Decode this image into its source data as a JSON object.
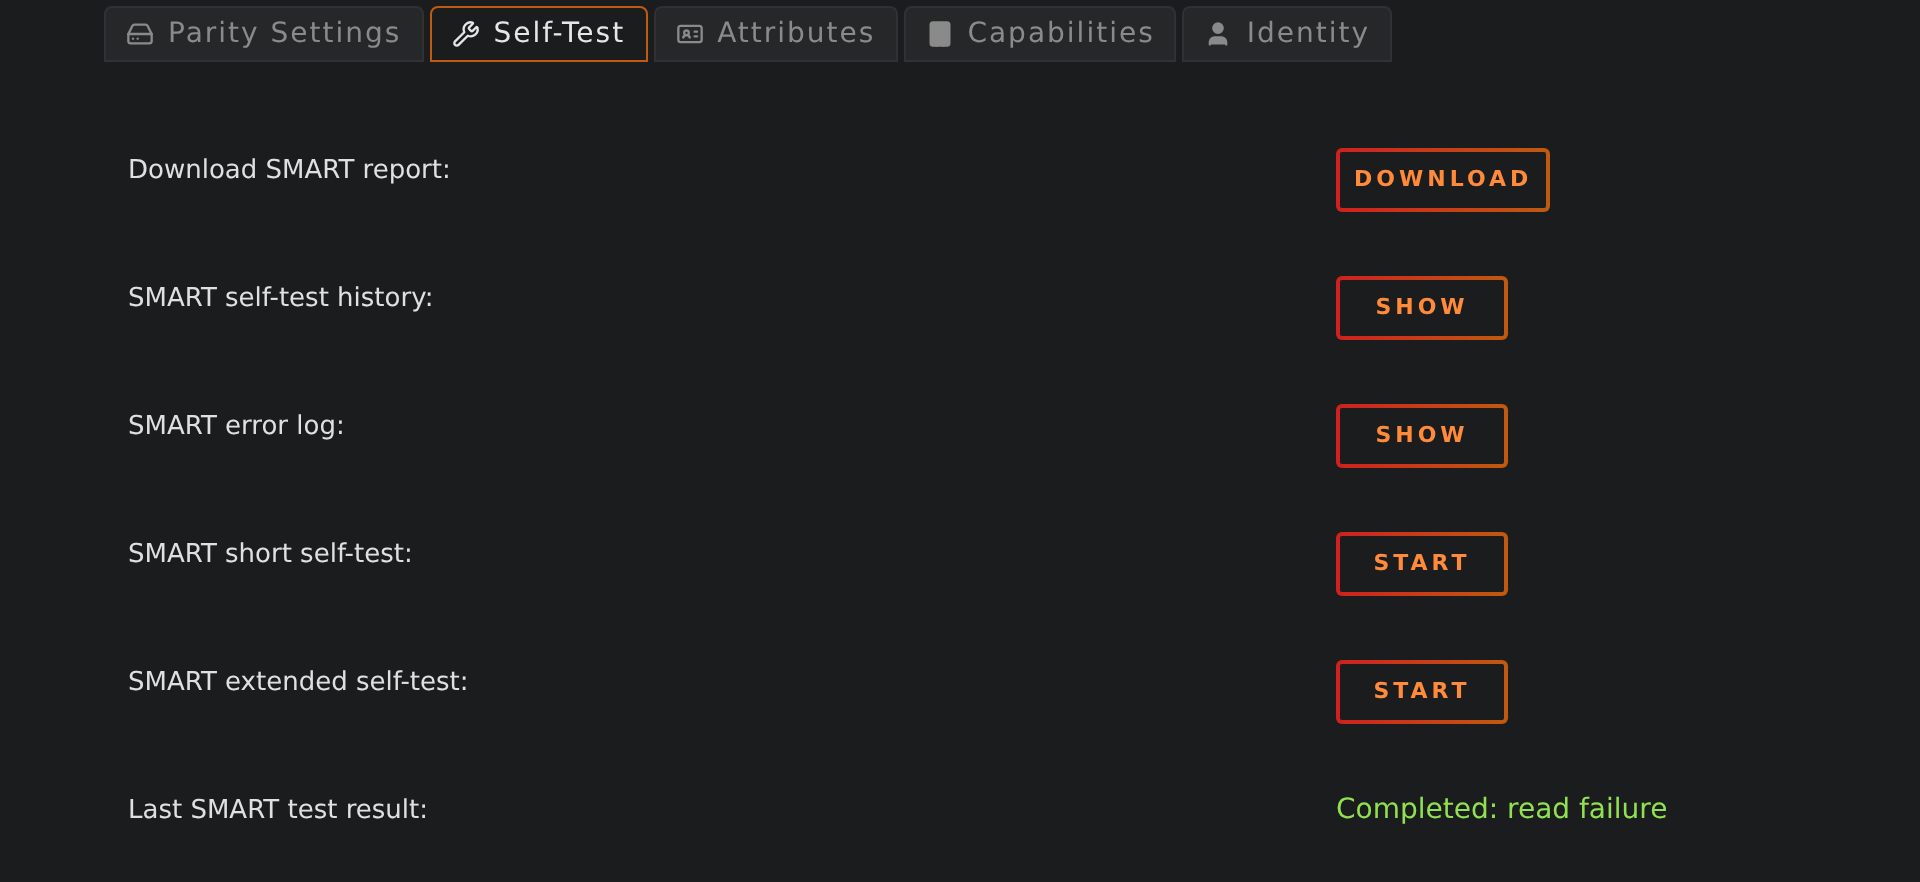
{
  "tabs": [
    {
      "label": "Parity Settings",
      "selected": false
    },
    {
      "label": "Self-Test",
      "selected": true
    },
    {
      "label": "Attributes",
      "selected": false
    },
    {
      "label": "Capabilities",
      "selected": false
    },
    {
      "label": "Identity",
      "selected": false
    }
  ],
  "rows": [
    {
      "label": "Download SMART report:",
      "kind": "button",
      "value": "DOWNLOAD"
    },
    {
      "label": "SMART self-test history:",
      "kind": "button",
      "value": "SHOW"
    },
    {
      "label": "SMART error log:",
      "kind": "button",
      "value": "SHOW"
    },
    {
      "label": "SMART short self-test:",
      "kind": "button",
      "value": "START"
    },
    {
      "label": "SMART extended self-test:",
      "kind": "button",
      "value": "START"
    },
    {
      "label": "Last SMART test result:",
      "kind": "status",
      "value": "Completed: read failure"
    }
  ]
}
